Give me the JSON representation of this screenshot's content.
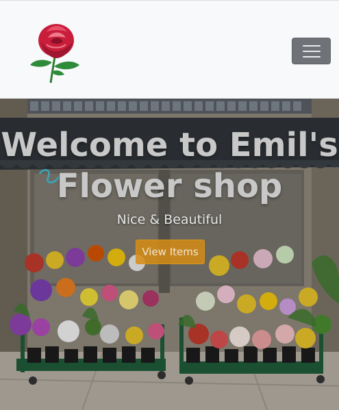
{
  "navbar": {
    "logo": "rose-logo",
    "toggler": "hamburger-icon"
  },
  "hero": {
    "title_line1": "Welcome to Emil's",
    "title_line2": "Flower shop",
    "subtitle": "Nice & Beautiful",
    "button_label": "View Items",
    "button_color": "#d68c14"
  }
}
